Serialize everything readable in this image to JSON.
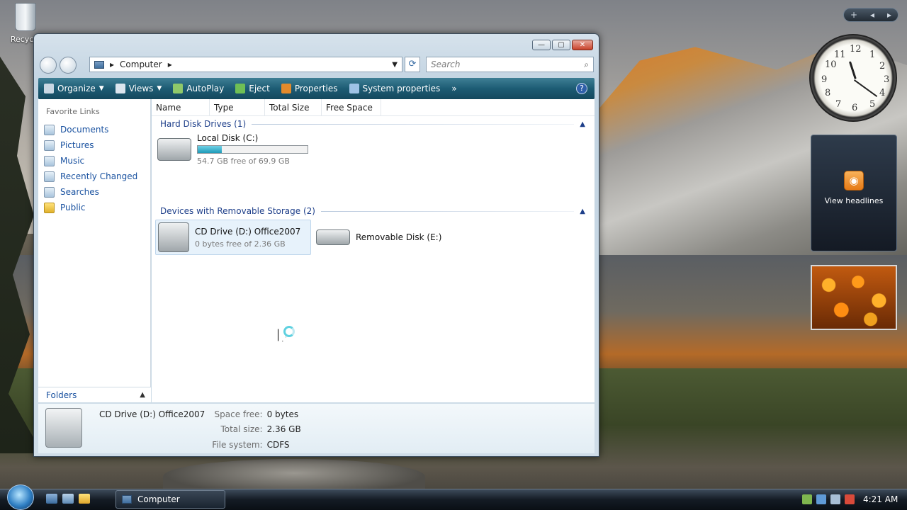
{
  "desktop": {
    "recycle_label": "Recycle"
  },
  "window": {
    "caption_buttons": {
      "minimize": "—",
      "maximize": "▢",
      "close": "✕"
    },
    "address": {
      "path": "Computer",
      "arrow": "▸"
    },
    "search": {
      "placeholder": "Search"
    },
    "toolbar": {
      "organize": "Organize",
      "views": "Views",
      "autoplay": "AutoPlay",
      "eject": "Eject",
      "properties": "Properties",
      "system_properties": "System properties",
      "more": "»",
      "help": "?"
    },
    "favorites": {
      "title": "Favorite Links",
      "items": [
        "Documents",
        "Pictures",
        "Music",
        "Recently Changed",
        "Searches",
        "Public"
      ]
    },
    "folders_label": "Folders",
    "columns": [
      "Name",
      "Type",
      "Total Size",
      "Free Space"
    ],
    "groups": {
      "hard_disks": "Hard Disk Drives (1)",
      "removable": "Devices with Removable Storage (2)"
    },
    "drives": {
      "c": {
        "name": "Local Disk (C:)",
        "free": "54.7 GB free of 69.9 GB",
        "used_fraction": 0.22
      },
      "d": {
        "name": "CD Drive (D:) Office2007",
        "free": "0 bytes free of 2.36 GB"
      },
      "e": {
        "name": "Removable Disk (E:)"
      }
    },
    "details": {
      "title": "CD Drive (D:) Office2007",
      "space_free_label": "Space free:",
      "space_free": "0 bytes",
      "total_size_label": "Total size:",
      "total_size": "2.36 GB",
      "file_system_label": "File system:",
      "file_system": "CDFS"
    }
  },
  "gadgets": {
    "sidebar_controls": {
      "add": "+",
      "prev": "◂",
      "next": "▸"
    },
    "clock_numbers": [
      "12",
      "1",
      "2",
      "3",
      "4",
      "5",
      "6",
      "7",
      "8",
      "9",
      "10",
      "11"
    ],
    "feed_label": "View headlines"
  },
  "taskbar": {
    "active_task": "Computer",
    "time": "4:21 AM"
  }
}
